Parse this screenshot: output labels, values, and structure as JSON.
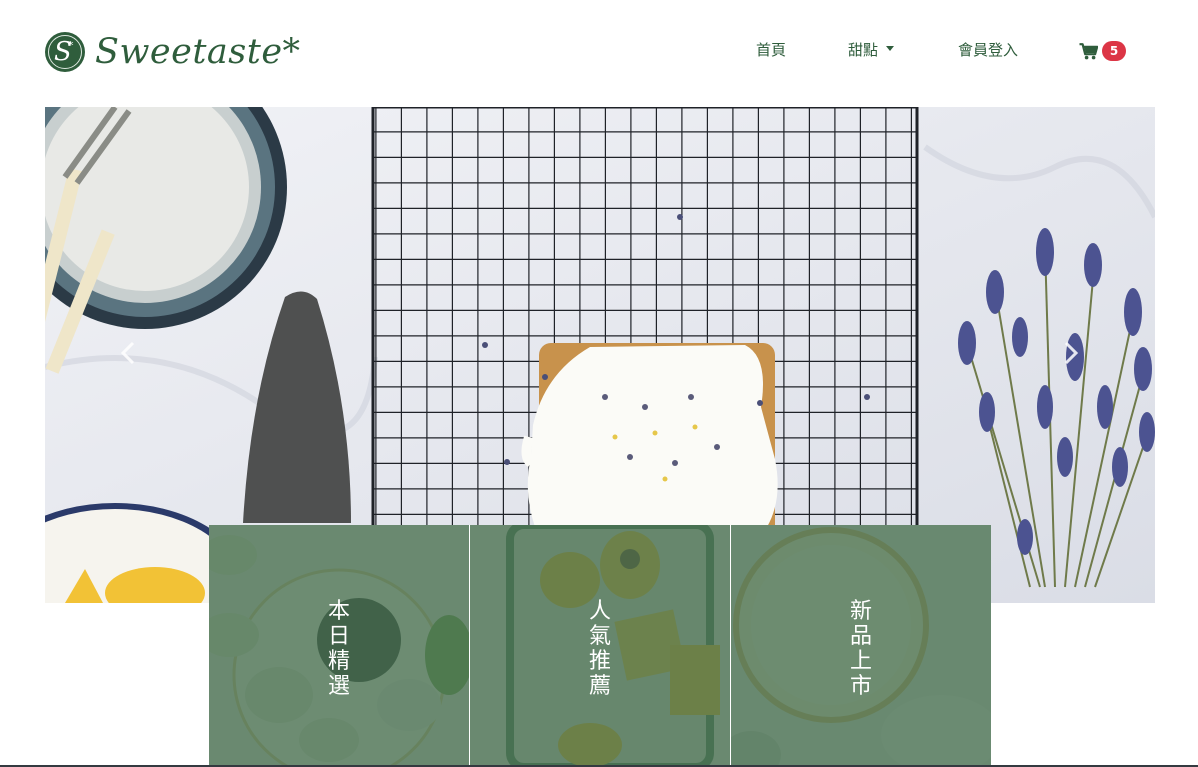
{
  "brand": {
    "name": "Sweetaste*",
    "logo_letter": "S"
  },
  "nav": {
    "home": "首頁",
    "desserts": "甜點",
    "login": "會員登入",
    "cart_count": "5"
  },
  "hero": {
    "image": "lemon-pound-cake-on-cooling-rack",
    "prev_icon": "chevron-left-icon",
    "next_icon": "chevron-right-icon"
  },
  "categories": [
    {
      "label": "本日精選"
    },
    {
      "label": "人氣推薦"
    },
    {
      "label": "新品上市"
    }
  ],
  "colors": {
    "brand_green": "#2f5d3c",
    "tile_overlay": "#466e50",
    "badge_red": "#dc3545"
  }
}
